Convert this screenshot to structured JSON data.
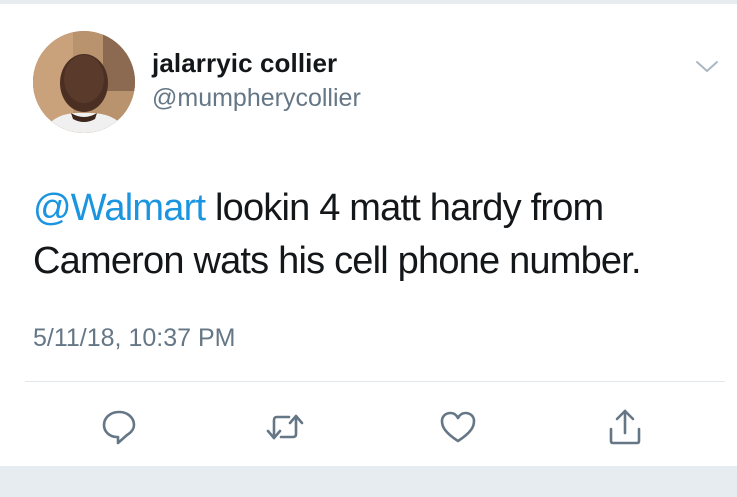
{
  "tweet": {
    "author": {
      "name": "jalarryic collier",
      "handle": "@mumpherycollier"
    },
    "text": {
      "mention": "@Walmart",
      "body": " lookin 4 matt hardy from Cameron wats his cell phone number."
    },
    "timestamp": "5/11/18, 10:37 PM",
    "actions": [
      {
        "icon": "reply-icon"
      },
      {
        "icon": "retweet-icon"
      },
      {
        "icon": "like-icon"
      },
      {
        "icon": "share-icon"
      }
    ]
  },
  "colors": {
    "text": "#14171a",
    "secondary": "#657786",
    "link": "#1b95e0",
    "divider": "#e1e8ed",
    "background_bar": "#e6ecf0"
  }
}
